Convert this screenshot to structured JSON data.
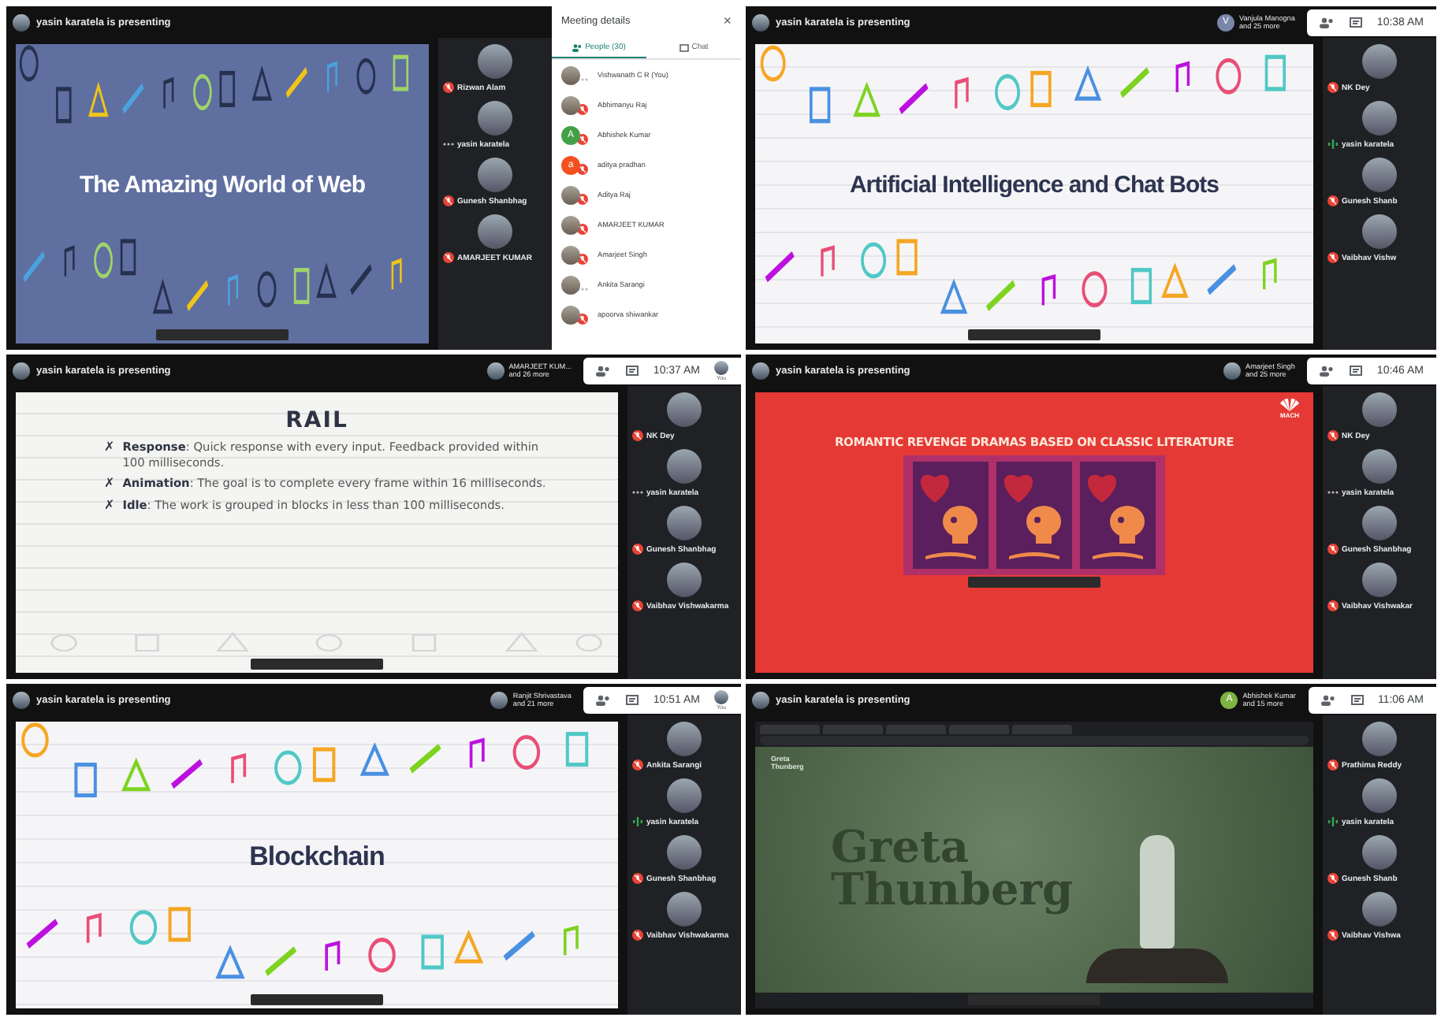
{
  "meetings": [
    {
      "banner": "yasin karatela is presenting",
      "slide": {
        "kind": "doodle",
        "dark_theme": true,
        "title": "The Amazing World of Web"
      },
      "participants": [
        {
          "name": "Rizwan Alam",
          "muted": true,
          "speaking": false
        },
        {
          "name": "yasin karatela",
          "muted": false,
          "speaking": false
        },
        {
          "name": "Gunesh Shanbhag",
          "muted": true,
          "speaking": false
        },
        {
          "name": "AMARJEET KUMAR",
          "muted": true,
          "speaking": false
        }
      ],
      "meeting_details": {
        "title": "Meeting details",
        "close": "×",
        "tabs": [
          {
            "label": "People (30)",
            "selected": true
          },
          {
            "label": "Chat",
            "selected": false
          }
        ],
        "people": [
          {
            "name": "Vishwanath C R (You)",
            "muted": false
          },
          {
            "name": "Abhimanyu Raj",
            "muted": true
          },
          {
            "name": "Abhishek Kumar",
            "muted": true,
            "initial": "A",
            "color": "#43a047"
          },
          {
            "name": "aditya pradhan",
            "muted": true,
            "initial": "a",
            "color": "#f4511e"
          },
          {
            "name": "Aditya Raj",
            "muted": true
          },
          {
            "name": "AMARJEET KUMAR",
            "muted": true
          },
          {
            "name": "Amarjeet Singh",
            "muted": true
          },
          {
            "name": "Ankita Sarangi",
            "muted": false
          },
          {
            "name": "apoorva shiwankar",
            "muted": true
          }
        ]
      }
    },
    {
      "banner": "yasin karatela is presenting",
      "presenter": {
        "name": "Vanjula Manogna",
        "more": "and 25 more",
        "initial": "V",
        "color": "#7986a8"
      },
      "toolbar": {
        "time": "10:38 AM"
      },
      "slide": {
        "kind": "doodle",
        "dark_theme": false,
        "title": "Artificial Intelligence and Chat Bots"
      },
      "participants": [
        {
          "name": "NK Dey",
          "muted": true,
          "speaking": false
        },
        {
          "name": "yasin karatela",
          "muted": false,
          "speaking": true
        },
        {
          "name": "Gunesh Shanb",
          "muted": true,
          "speaking": false
        },
        {
          "name": "Vaibhav Vishw",
          "muted": true,
          "speaking": false
        }
      ]
    },
    {
      "banner": "yasin karatela is presenting",
      "presenter": {
        "name": "AMARJEET KUM...",
        "more": "and 26 more"
      },
      "toolbar": {
        "time": "10:37 AM",
        "self_label": "You"
      },
      "slide": {
        "kind": "bullets",
        "title": "RAIL",
        "bullet_glyph": "✗",
        "bullets": [
          "**Response**: Quick response with every input. Feedback provided within 100 milliseconds.",
          "**Animation**: The goal is to complete every frame within 16 milliseconds.",
          "**Idle**: The work is grouped in blocks in less than 100 milliseconds."
        ]
      },
      "participants": [
        {
          "name": "NK Dey",
          "muted": true,
          "speaking": false
        },
        {
          "name": "yasin karatela",
          "muted": false,
          "speaking": false
        },
        {
          "name": "Gunesh Shanbhag",
          "muted": true,
          "speaking": false
        },
        {
          "name": "Vaibhav Vishwakarma",
          "muted": true,
          "speaking": false
        }
      ]
    },
    {
      "banner": "yasin karatela is presenting",
      "presenter": {
        "name": "Amarjeet Singh",
        "more": "and 25 more"
      },
      "toolbar": {
        "time": "10:46 AM"
      },
      "slide": {
        "kind": "poster",
        "title": "ROMANTIC REVENGE DRAMAS BASED ON CLASSIC LITERATURE",
        "logo_text": "MACH"
      },
      "participants": [
        {
          "name": "NK Dey",
          "muted": true,
          "speaking": false
        },
        {
          "name": "yasin karatela",
          "muted": false,
          "speaking": false
        },
        {
          "name": "Gunesh Shanbhag",
          "muted": true,
          "speaking": false
        },
        {
          "name": "Vaibhav Vishwakar",
          "muted": true,
          "speaking": false
        }
      ]
    },
    {
      "banner": "yasin karatela is presenting",
      "presenter": {
        "name": "Ranjit Shrivastava",
        "more": "and 21 more"
      },
      "toolbar": {
        "time": "10:51 AM",
        "self_label": "You"
      },
      "slide": {
        "kind": "doodle",
        "dark_theme": false,
        "title": "Blockchain"
      },
      "participants": [
        {
          "name": "Ankita Sarangi",
          "muted": true,
          "speaking": false
        },
        {
          "name": "yasin karatela",
          "muted": false,
          "speaking": true
        },
        {
          "name": "Gunesh Shanbhag",
          "muted": true,
          "speaking": false
        },
        {
          "name": "Vaibhav Vishwakarma",
          "muted": true,
          "speaking": false
        }
      ]
    },
    {
      "banner": "yasin karatela is presenting",
      "presenter": {
        "name": "Abhishek Kumar",
        "more": "and 15 more",
        "initial": "A",
        "color": "#7cb342"
      },
      "toolbar": {
        "time": "11:06 AM"
      },
      "slide": {
        "kind": "website",
        "site_label": "Greta Thunberg",
        "headline": [
          "Greta",
          "Thunberg"
        ]
      },
      "participants": [
        {
          "name": "Prathima Reddy",
          "muted": true,
          "speaking": false
        },
        {
          "name": "yasin karatela",
          "muted": false,
          "speaking": true
        },
        {
          "name": "Gunesh Shanb",
          "muted": true,
          "speaking": false
        },
        {
          "name": "Vaibhav Vishwa",
          "muted": true,
          "speaking": false
        }
      ]
    }
  ]
}
